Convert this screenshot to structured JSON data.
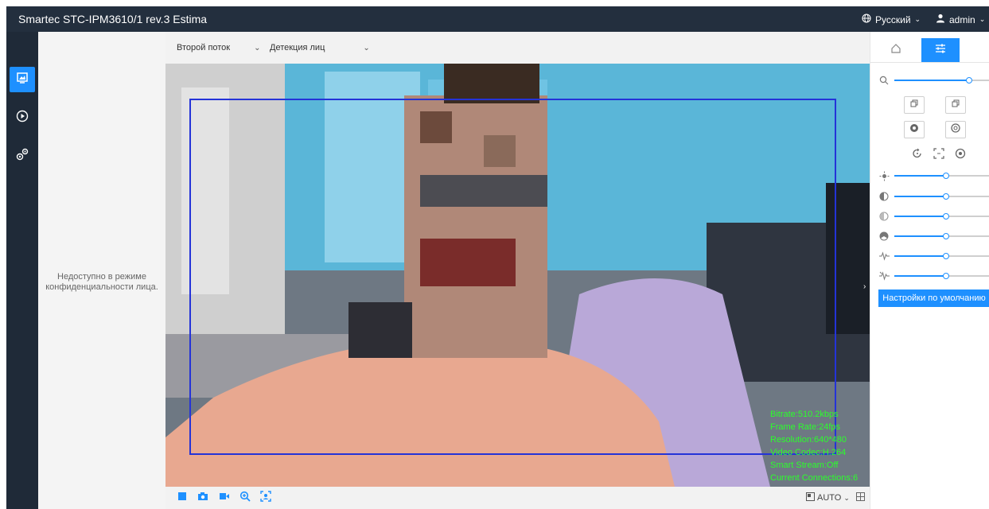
{
  "app": {
    "title": "Smartec STC-IPM3610/1 rev.3 Estima"
  },
  "header": {
    "language": "Русский",
    "user": "admin"
  },
  "icons": {
    "language": "globe-icon",
    "user": "user-icon",
    "nav": [
      "live-view-icon",
      "playback-icon",
      "settings-icon"
    ],
    "toolbar": [
      "stop-icon",
      "snapshot-icon",
      "record-icon",
      "zoom-icon",
      "face-capture-icon"
    ],
    "right_tabs": [
      "home-icon",
      "image-adjust-icon"
    ]
  },
  "colors": {
    "accent": "#1e90ff",
    "topbar": "#232f3e",
    "osd_text": "#2bff2b",
    "detect_box": "#2433d8"
  },
  "sidepanel": {
    "note": "Недоступно в режиме конфиденциальности лица."
  },
  "streambar": {
    "stream_select": "Второй поток",
    "mode_select": "Детекция лиц"
  },
  "osd": {
    "bitrate": "Bitrate:510.2kbps",
    "frame_rate": "Frame Rate:24fps",
    "resolution": "Resolution:640*480",
    "codec": "Video Codec:H.264",
    "smart_stream": "Smart Stream:Off",
    "connections": "Current Connections:6"
  },
  "bottombar": {
    "ratio": "AUTO"
  },
  "rightpanel": {
    "zoom_level": 0.72,
    "sliders": [
      {
        "name": "brightness",
        "icon": "brightness-icon",
        "value": 0.5
      },
      {
        "name": "contrast",
        "icon": "contrast-icon",
        "value": 0.5
      },
      {
        "name": "saturation",
        "icon": "saturation-icon",
        "value": 0.5
      },
      {
        "name": "sharpness",
        "icon": "sharpness-icon",
        "value": 0.5
      },
      {
        "name": "noise-reduction-2d",
        "icon": "noise-2d-icon",
        "value": 0.5
      },
      {
        "name": "noise-reduction-3d",
        "icon": "noise-3d-icon",
        "value": 0.5
      }
    ],
    "default_button": "Настройки по умолчанию"
  }
}
